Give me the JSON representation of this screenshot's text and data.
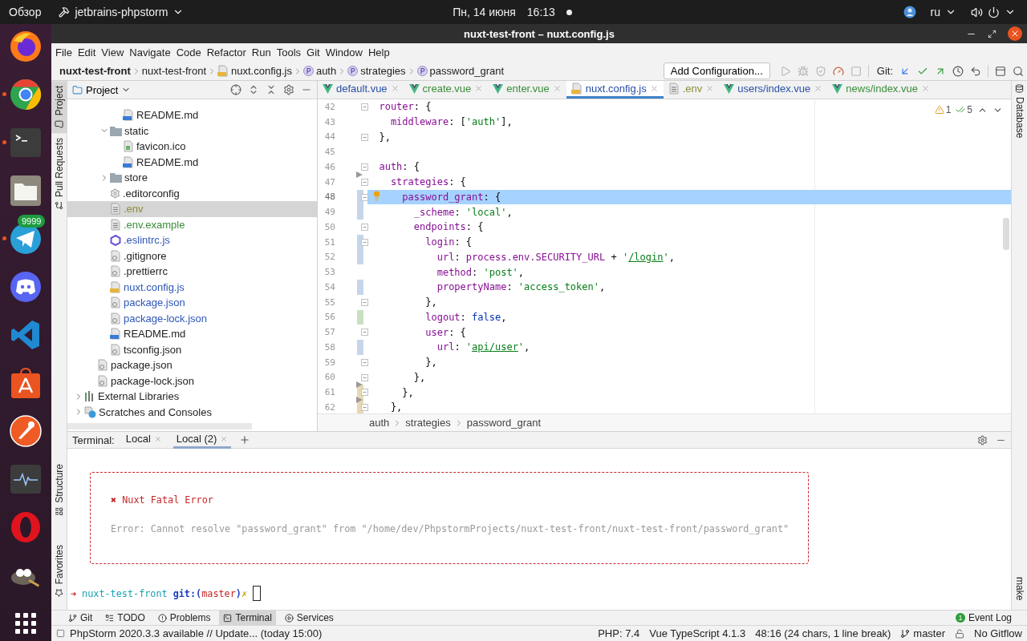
{
  "top_bar": {
    "activities": "Обзор",
    "app": "jetbrains-phpstorm",
    "date": "Пн, 14 июня",
    "time": "16:13",
    "language": "ru"
  },
  "dock": [
    {
      "kind": "firefox",
      "running": false
    },
    {
      "kind": "chrome",
      "running": true
    },
    {
      "kind": "terminal",
      "running": true
    },
    {
      "kind": "files",
      "running": false
    },
    {
      "kind": "telegram",
      "running": true,
      "badge": "9999"
    },
    {
      "kind": "discord",
      "running": false
    },
    {
      "kind": "vscode",
      "running": false
    },
    {
      "kind": "software",
      "running": false
    },
    {
      "kind": "postman",
      "running": false
    },
    {
      "kind": "monitor",
      "running": false
    },
    {
      "kind": "opera",
      "running": false
    },
    {
      "kind": "gimp",
      "running": false
    },
    {
      "kind": "apps",
      "running": false
    }
  ],
  "window": {
    "title": "nuxt-test-front – nuxt.config.js"
  },
  "menu": [
    "File",
    "Edit",
    "View",
    "Navigate",
    "Code",
    "Refactor",
    "Run",
    "Tools",
    "Git",
    "Window",
    "Help"
  ],
  "nav_bar": {
    "crumbs": [
      {
        "label": "nuxt-test-front",
        "kind": "project"
      },
      {
        "label": "nuxt-test-front",
        "kind": "folder"
      },
      {
        "label": "nuxt.config.js",
        "kind": "file"
      },
      {
        "label": "auth",
        "kind": "property"
      },
      {
        "label": "strategies",
        "kind": "property"
      },
      {
        "label": "password_grant",
        "kind": "property"
      }
    ],
    "run_config": "Add Configuration...",
    "run_tools": [
      {
        "kind": "run",
        "disabled": true
      },
      {
        "kind": "debug",
        "disabled": true
      },
      {
        "kind": "coverage",
        "disabled": true
      },
      {
        "kind": "profile",
        "disabled": false
      },
      {
        "kind": "stop",
        "disabled": true
      }
    ],
    "git": {
      "label": "Git:",
      "tools": [
        {
          "kind": "update",
          "disabled": false
        },
        {
          "kind": "commit",
          "disabled": false
        },
        {
          "kind": "push",
          "disabled": false
        },
        {
          "kind": "history",
          "disabled": false
        },
        {
          "kind": "rollback",
          "disabled": false
        }
      ]
    },
    "window_tools": [
      {
        "kind": "layout",
        "disabled": false
      },
      {
        "kind": "search",
        "disabled": false
      }
    ]
  },
  "left_stripe": {
    "top": [
      {
        "label": "Project",
        "kind": "project",
        "selected": true
      },
      {
        "label": "Pull Requests",
        "kind": "pull",
        "selected": false
      }
    ],
    "bottom": [
      {
        "label": "Structure",
        "kind": "structure",
        "selected": false
      },
      {
        "label": "Favorites",
        "kind": "favorites",
        "selected": false
      }
    ]
  },
  "right_stripe": {
    "top": "Database",
    "bottom": "make"
  },
  "project": {
    "title": "Project",
    "tree": [
      {
        "children": [
          {
            "children": [
              {
                "children": [
                  {
                    "name": "README.md",
                    "kind": "md",
                    "color": "#1e1e1e",
                    "selected": false
                  }
                ]
              },
              {
                "name": "static",
                "kind": "folder",
                "color": "#1e1e1e",
                "selected": false,
                "expanded": true,
                "children": [
                  {
                    "name": "favicon.ico",
                    "kind": "ico",
                    "color": "#1e1e1e",
                    "selected": false
                  },
                  {
                    "name": "README.md",
                    "kind": "md",
                    "color": "#1e1e1e",
                    "selected": false
                  }
                ]
              },
              {
                "name": "store",
                "kind": "folder",
                "color": "#1e1e1e",
                "selected": false,
                "expanded": false
              },
              {
                "name": ".editorconfig",
                "kind": "config",
                "color": "#1e1e1e",
                "selected": false
              },
              {
                "name": ".env",
                "kind": "text",
                "color": "#8c8c3c",
                "selected": true
              },
              {
                "name": ".env.example",
                "kind": "text",
                "color": "#3a8e3a",
                "selected": false
              },
              {
                "name": ".eslintrc.js",
                "kind": "eslint",
                "color": "#2e56b8",
                "selected": false
              },
              {
                "name": ".gitignore",
                "kind": "json",
                "color": "#1e1e1e",
                "selected": false
              },
              {
                "name": ".prettierrc",
                "kind": "json",
                "color": "#1e1e1e",
                "selected": false
              },
              {
                "name": "nuxt.config.js",
                "kind": "js",
                "color": "#2e56b8",
                "selected": false
              },
              {
                "name": "package.json",
                "kind": "json",
                "color": "#2e56b8",
                "selected": false
              },
              {
                "name": "package-lock.json",
                "kind": "json",
                "color": "#2e56b8",
                "selected": false
              },
              {
                "name": "README.md",
                "kind": "md",
                "color": "#1e1e1e",
                "selected": false
              },
              {
                "name": "tsconfig.json",
                "kind": "json",
                "color": "#1e1e1e",
                "selected": false
              }
            ]
          },
          {
            "name": "package.json",
            "kind": "json",
            "color": "#1e1e1e",
            "selected": false
          },
          {
            "name": "package-lock.json",
            "kind": "json",
            "color": "#1e1e1e",
            "selected": false
          }
        ]
      },
      {
        "name": "External Libraries",
        "kind": "lib",
        "color": "#1e1e1e",
        "selected": false,
        "expanded": false
      },
      {
        "name": "Scratches and Consoles",
        "kind": "scratch",
        "color": "#1e1e1e",
        "selected": false,
        "expanded": false
      }
    ]
  },
  "editor": {
    "tabs": [
      {
        "label": "default.vue",
        "kind": "vue",
        "color": "#2850a8",
        "selected": false
      },
      {
        "label": "create.vue",
        "kind": "vue",
        "color": "#3a8e3a",
        "selected": false
      },
      {
        "label": "enter.vue",
        "kind": "vue",
        "color": "#3a8e3a",
        "selected": false
      },
      {
        "label": "nuxt.config.js",
        "kind": "js",
        "color": "#2850a8",
        "selected": true
      },
      {
        "label": ".env",
        "kind": "text",
        "color": "#8c8c3c",
        "selected": false
      },
      {
        "label": "users/index.vue",
        "kind": "vue",
        "color": "#2850a8",
        "selected": false
      },
      {
        "label": "news/index.vue",
        "kind": "vue",
        "color": "#3a8e3a",
        "selected": false
      }
    ],
    "inspections": {
      "warnings": "1",
      "checks": "5"
    },
    "lines": [
      {
        "num": "42",
        "fold": true,
        "kind": "plain",
        "current": false,
        "segs": [
          {
            "kind": "key",
            "text": "  router"
          },
          {
            "kind": "punct",
            "text": ": {"
          }
        ]
      },
      {
        "num": "43",
        "fold": false,
        "kind": "plain",
        "current": false,
        "segs": [
          {
            "kind": "key",
            "text": "    middleware"
          },
          {
            "kind": "punct",
            "text": ": ["
          },
          {
            "kind": "string",
            "text": "'auth'"
          },
          {
            "kind": "punct",
            "text": "],"
          }
        ]
      },
      {
        "num": "44",
        "fold": true,
        "kind": "plain",
        "current": false,
        "segs": [
          {
            "kind": "punct",
            "text": "  },"
          }
        ]
      },
      {
        "num": "45",
        "fold": false,
        "kind": "plain",
        "current": false
      },
      {
        "num": "46",
        "fold": true,
        "kind": "plain",
        "current": false,
        "segs": [
          {
            "kind": "key",
            "text": "  auth"
          },
          {
            "kind": "punct",
            "text": ": {"
          }
        ]
      },
      {
        "num": "47",
        "fold": true,
        "kind": "deleted",
        "current": false,
        "segs": [
          {
            "kind": "key",
            "text": "    strategies"
          },
          {
            "kind": "punct",
            "text": ": {"
          }
        ]
      },
      {
        "num": "48",
        "fold": true,
        "kind": "modified",
        "current": true,
        "intention": true,
        "segs": [
          {
            "kind": "key",
            "text": "      password_grant"
          },
          {
            "kind": "punct",
            "text": ": {"
          }
        ]
      },
      {
        "num": "49",
        "fold": false,
        "kind": "modified",
        "current": false,
        "segs": [
          {
            "kind": "key",
            "text": "        _scheme"
          },
          {
            "kind": "punct",
            "text": ": "
          },
          {
            "kind": "string",
            "text": "'local'"
          },
          {
            "kind": "punct",
            "text": ","
          }
        ]
      },
      {
        "num": "50",
        "fold": true,
        "kind": "plain",
        "current": false,
        "segs": [
          {
            "kind": "key",
            "text": "        endpoints"
          },
          {
            "kind": "punct",
            "text": ": {"
          }
        ]
      },
      {
        "num": "51",
        "fold": true,
        "kind": "modified",
        "current": false,
        "segs": [
          {
            "kind": "key",
            "text": "          login"
          },
          {
            "kind": "punct",
            "text": ": {"
          }
        ]
      },
      {
        "num": "52",
        "fold": false,
        "kind": "modified",
        "current": false,
        "segs": [
          {
            "kind": "key",
            "text": "            url"
          },
          {
            "kind": "punct",
            "text": ": "
          },
          {
            "kind": "key",
            "text": "process.env.SECURITY_URL"
          },
          {
            "kind": "punct",
            "text": " + "
          },
          {
            "kind": "string",
            "text": "'"
          },
          {
            "kind": "link",
            "text": "/login"
          },
          {
            "kind": "string",
            "text": "'"
          },
          {
            "kind": "punct",
            "text": ","
          }
        ]
      },
      {
        "num": "53",
        "fold": false,
        "kind": "plain",
        "current": false,
        "segs": [
          {
            "kind": "key",
            "text": "            method"
          },
          {
            "kind": "punct",
            "text": ": "
          },
          {
            "kind": "string",
            "text": "'post'"
          },
          {
            "kind": "punct",
            "text": ","
          }
        ]
      },
      {
        "num": "54",
        "fold": false,
        "kind": "modified",
        "current": false,
        "segs": [
          {
            "kind": "key",
            "text": "            propertyName"
          },
          {
            "kind": "punct",
            "text": ": "
          },
          {
            "kind": "string",
            "text": "'access_token'"
          },
          {
            "kind": "punct",
            "text": ","
          }
        ]
      },
      {
        "num": "55",
        "fold": true,
        "kind": "plain",
        "current": false,
        "segs": [
          {
            "kind": "punct",
            "text": "          },"
          }
        ]
      },
      {
        "num": "56",
        "fold": false,
        "kind": "added",
        "current": false,
        "segs": [
          {
            "kind": "key",
            "text": "          logout"
          },
          {
            "kind": "punct",
            "text": ": "
          },
          {
            "kind": "literal",
            "text": "false"
          },
          {
            "kind": "punct",
            "text": ","
          }
        ]
      },
      {
        "num": "57",
        "fold": true,
        "kind": "plain",
        "current": false,
        "segs": [
          {
            "kind": "key",
            "text": "          user"
          },
          {
            "kind": "punct",
            "text": ": {"
          }
        ]
      },
      {
        "num": "58",
        "fold": false,
        "kind": "modified",
        "current": false,
        "segs": [
          {
            "kind": "key",
            "text": "            url"
          },
          {
            "kind": "punct",
            "text": ": "
          },
          {
            "kind": "string",
            "text": "'"
          },
          {
            "kind": "link",
            "text": "api/user"
          },
          {
            "kind": "string",
            "text": "'"
          },
          {
            "kind": "punct",
            "text": ","
          }
        ]
      },
      {
        "num": "59",
        "fold": true,
        "kind": "plain",
        "current": false,
        "segs": [
          {
            "kind": "punct",
            "text": "          },"
          }
        ]
      },
      {
        "num": "60",
        "fold": true,
        "kind": "plain",
        "current": false,
        "segs": [
          {
            "kind": "punct",
            "text": "        },"
          }
        ]
      },
      {
        "num": "61",
        "fold": true,
        "kind": "changed",
        "current": false,
        "segs": [
          {
            "kind": "punct",
            "text": "      },"
          }
        ]
      },
      {
        "num": "62",
        "fold": true,
        "kind": "changed",
        "current": false,
        "segs": [
          {
            "kind": "punct",
            "text": "    },"
          }
        ]
      }
    ],
    "breadcrumbs": [
      "auth",
      "strategies",
      "password_grant"
    ]
  },
  "terminal": {
    "label": "Terminal:",
    "tabs": [
      {
        "label": "Local",
        "selected": false
      },
      {
        "label": "Local (2)",
        "selected": true
      }
    ],
    "error": {
      "mark": "✖",
      "title": "Nuxt Fatal Error",
      "message": "Error: Cannot resolve \"password_grant\" from \"/home/dev/PhpstormProjects/nuxt-test-front/nuxt-test-front/password_grant\""
    },
    "prompt": [
      {
        "kind": "arrow",
        "text": "➜"
      },
      {
        "kind": "dir",
        "text": "nuxt-test-front"
      },
      {
        "kind": "git",
        "text": "git:("
      },
      {
        "kind": "branch",
        "text": "master"
      },
      {
        "kind": "git",
        "text": ")"
      },
      {
        "kind": "dirty",
        "text": "✗"
      }
    ]
  },
  "tool_tabs": [
    {
      "label": "Git",
      "kind": "git",
      "selected": false
    },
    {
      "label": "TODO",
      "kind": "todo",
      "selected": false
    },
    {
      "label": "Problems",
      "kind": "problems",
      "selected": false
    },
    {
      "label": "Terminal",
      "kind": "terminal",
      "selected": true
    },
    {
      "label": "Services",
      "kind": "services",
      "selected": false
    }
  ],
  "event_log": {
    "label": "Event Log",
    "count": "1"
  },
  "status_bar": {
    "message": "PhpStorm 2020.3.3 available // Update... (today 15:00)",
    "items": [
      "PHP: 7.4",
      "Vue TypeScript 4.1.3",
      "48:16 (24 chars, 1 line break)"
    ],
    "branch": "master",
    "gitflow": "No Gitflow"
  }
}
